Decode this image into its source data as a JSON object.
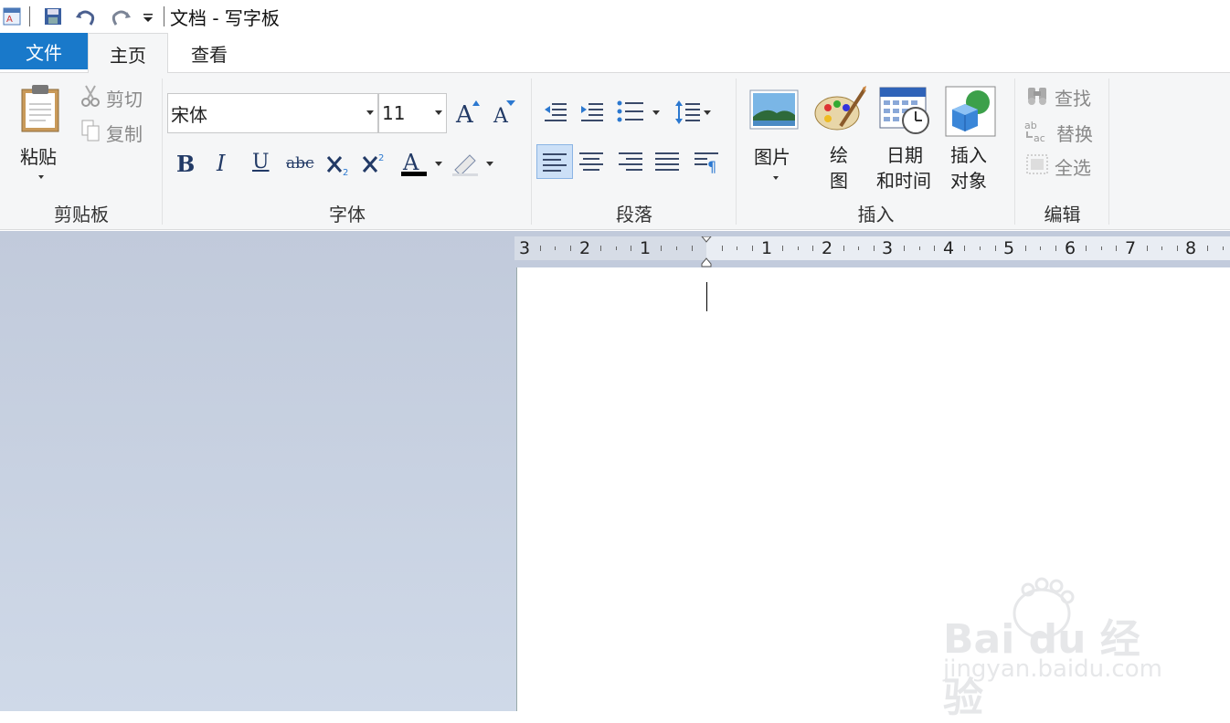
{
  "window": {
    "title": "文档 - 写字板"
  },
  "tabs": [
    {
      "label": "文件"
    },
    {
      "label": "主页"
    },
    {
      "label": "查看"
    }
  ],
  "clipboard": {
    "paste_label": "粘贴",
    "cut_label": "剪切",
    "copy_label": "复制",
    "group_label": "剪贴板"
  },
  "font": {
    "family": "宋体",
    "size": "11",
    "group_label": "字体",
    "bold": "B",
    "italic": "I",
    "underline": "U",
    "strike": "abc"
  },
  "paragraph": {
    "group_label": "段落"
  },
  "insert": {
    "picture_label": "图片",
    "paint_label_1": "绘",
    "paint_label_2": "图",
    "datetime_label_1": "日期",
    "datetime_label_2": "和时间",
    "object_label_1": "插入",
    "object_label_2": "对象",
    "group_label": "插入"
  },
  "editing": {
    "find_label": "查找",
    "replace_label": "替换",
    "select_all_label": "全选",
    "group_label": "编辑"
  },
  "ruler": {
    "labels": [
      "3",
      "2",
      "1",
      "1",
      "2",
      "3",
      "4",
      "5",
      "6",
      "7",
      "8"
    ]
  },
  "watermark": {
    "brand": "Bai du 经验",
    "url": "jingyan.baidu.com"
  },
  "colors": {
    "accent": "#1979ca",
    "ribbon_bg": "#f5f6f7",
    "workspace": "#c7d0e0"
  }
}
